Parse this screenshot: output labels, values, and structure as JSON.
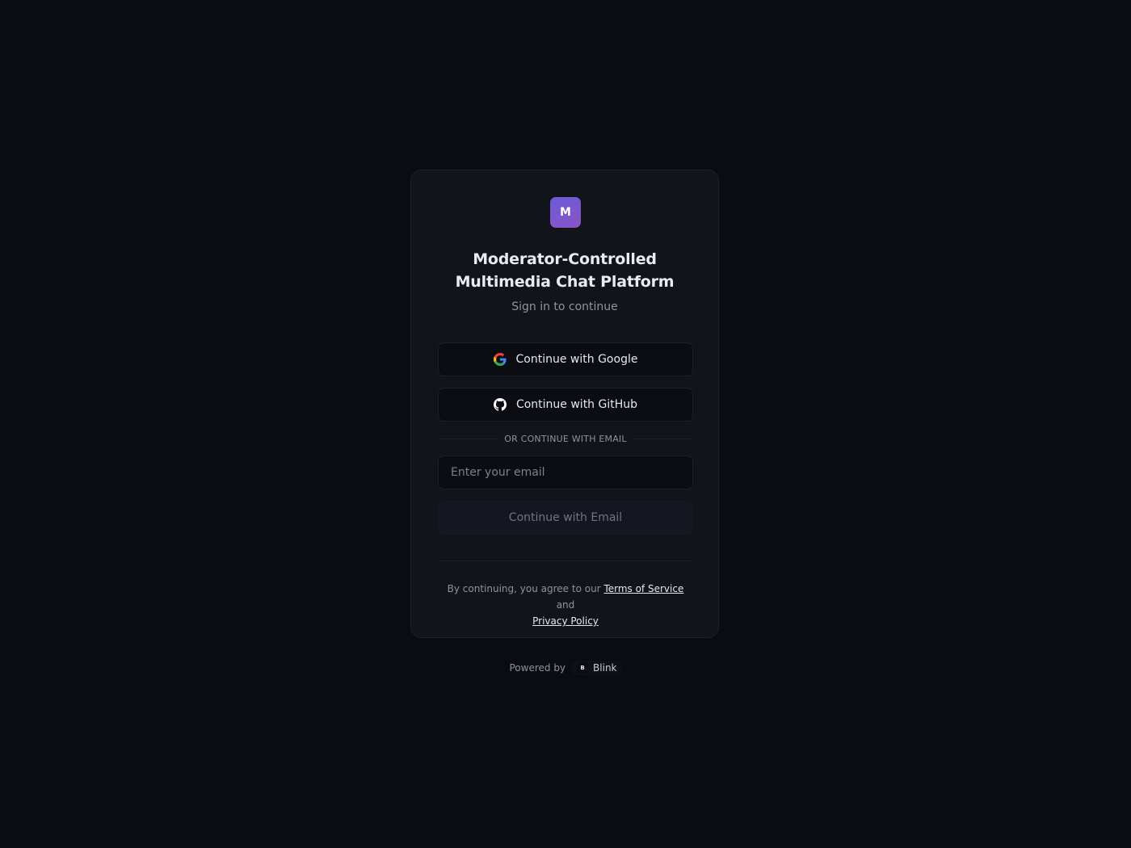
{
  "app": {
    "logo_letter": "M",
    "title_line1": "Moderator-Controlled",
    "title_line2": "Multimedia Chat Platform",
    "subtitle": "Sign in to continue"
  },
  "auth": {
    "google_label": "Continue with Google",
    "github_label": "Continue with GitHub",
    "divider_label": "OR CONTINUE WITH EMAIL",
    "email_placeholder": "Enter your email",
    "email_value": "",
    "email_button_label": "Continue with Email"
  },
  "legal": {
    "prefix": "By continuing, you agree to our ",
    "terms_label": "Terms of Service",
    "middle": " and",
    "privacy_label": "Privacy Policy"
  },
  "footer": {
    "powered_by": "Powered by",
    "brand_letter": "B",
    "brand_name": "Blink"
  },
  "icons": {
    "google": "google-icon",
    "github": "github-icon"
  },
  "colors": {
    "background": "#0a0c13",
    "card": "#11141b",
    "accent_start": "#6c5ad8",
    "accent_end": "#8a55c6"
  }
}
